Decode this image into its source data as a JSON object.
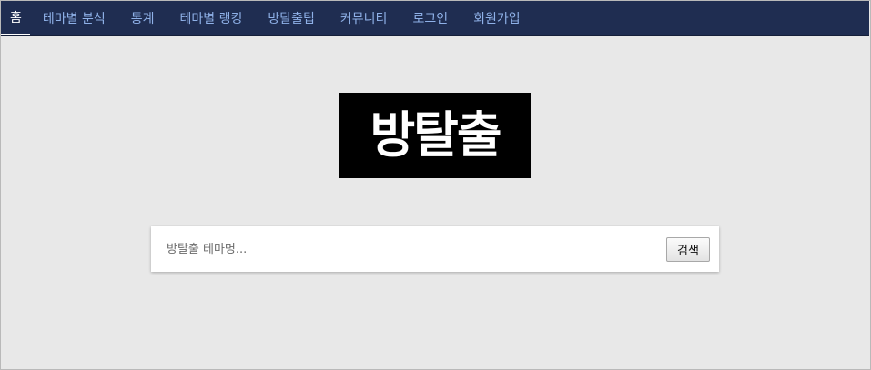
{
  "nav": {
    "items": [
      {
        "label": "홈",
        "active": true
      },
      {
        "label": "테마별 분석",
        "active": false
      },
      {
        "label": "통계",
        "active": false
      },
      {
        "label": "테마별 랭킹",
        "active": false
      },
      {
        "label": "방탈출팁",
        "active": false
      },
      {
        "label": "커뮤니티",
        "active": false
      },
      {
        "label": "로그인",
        "active": false
      },
      {
        "label": "회원가입",
        "active": false
      }
    ]
  },
  "logo": {
    "text": "방탈출"
  },
  "search": {
    "placeholder": "방탈출 테마명...",
    "value": "",
    "button_label": "검색"
  },
  "colors": {
    "navbar_bg": "#1f2d51",
    "nav_link": "#8fb1e8",
    "nav_active": "#ffffff",
    "page_bg": "#e8e8e8",
    "logo_bg": "#000000"
  }
}
